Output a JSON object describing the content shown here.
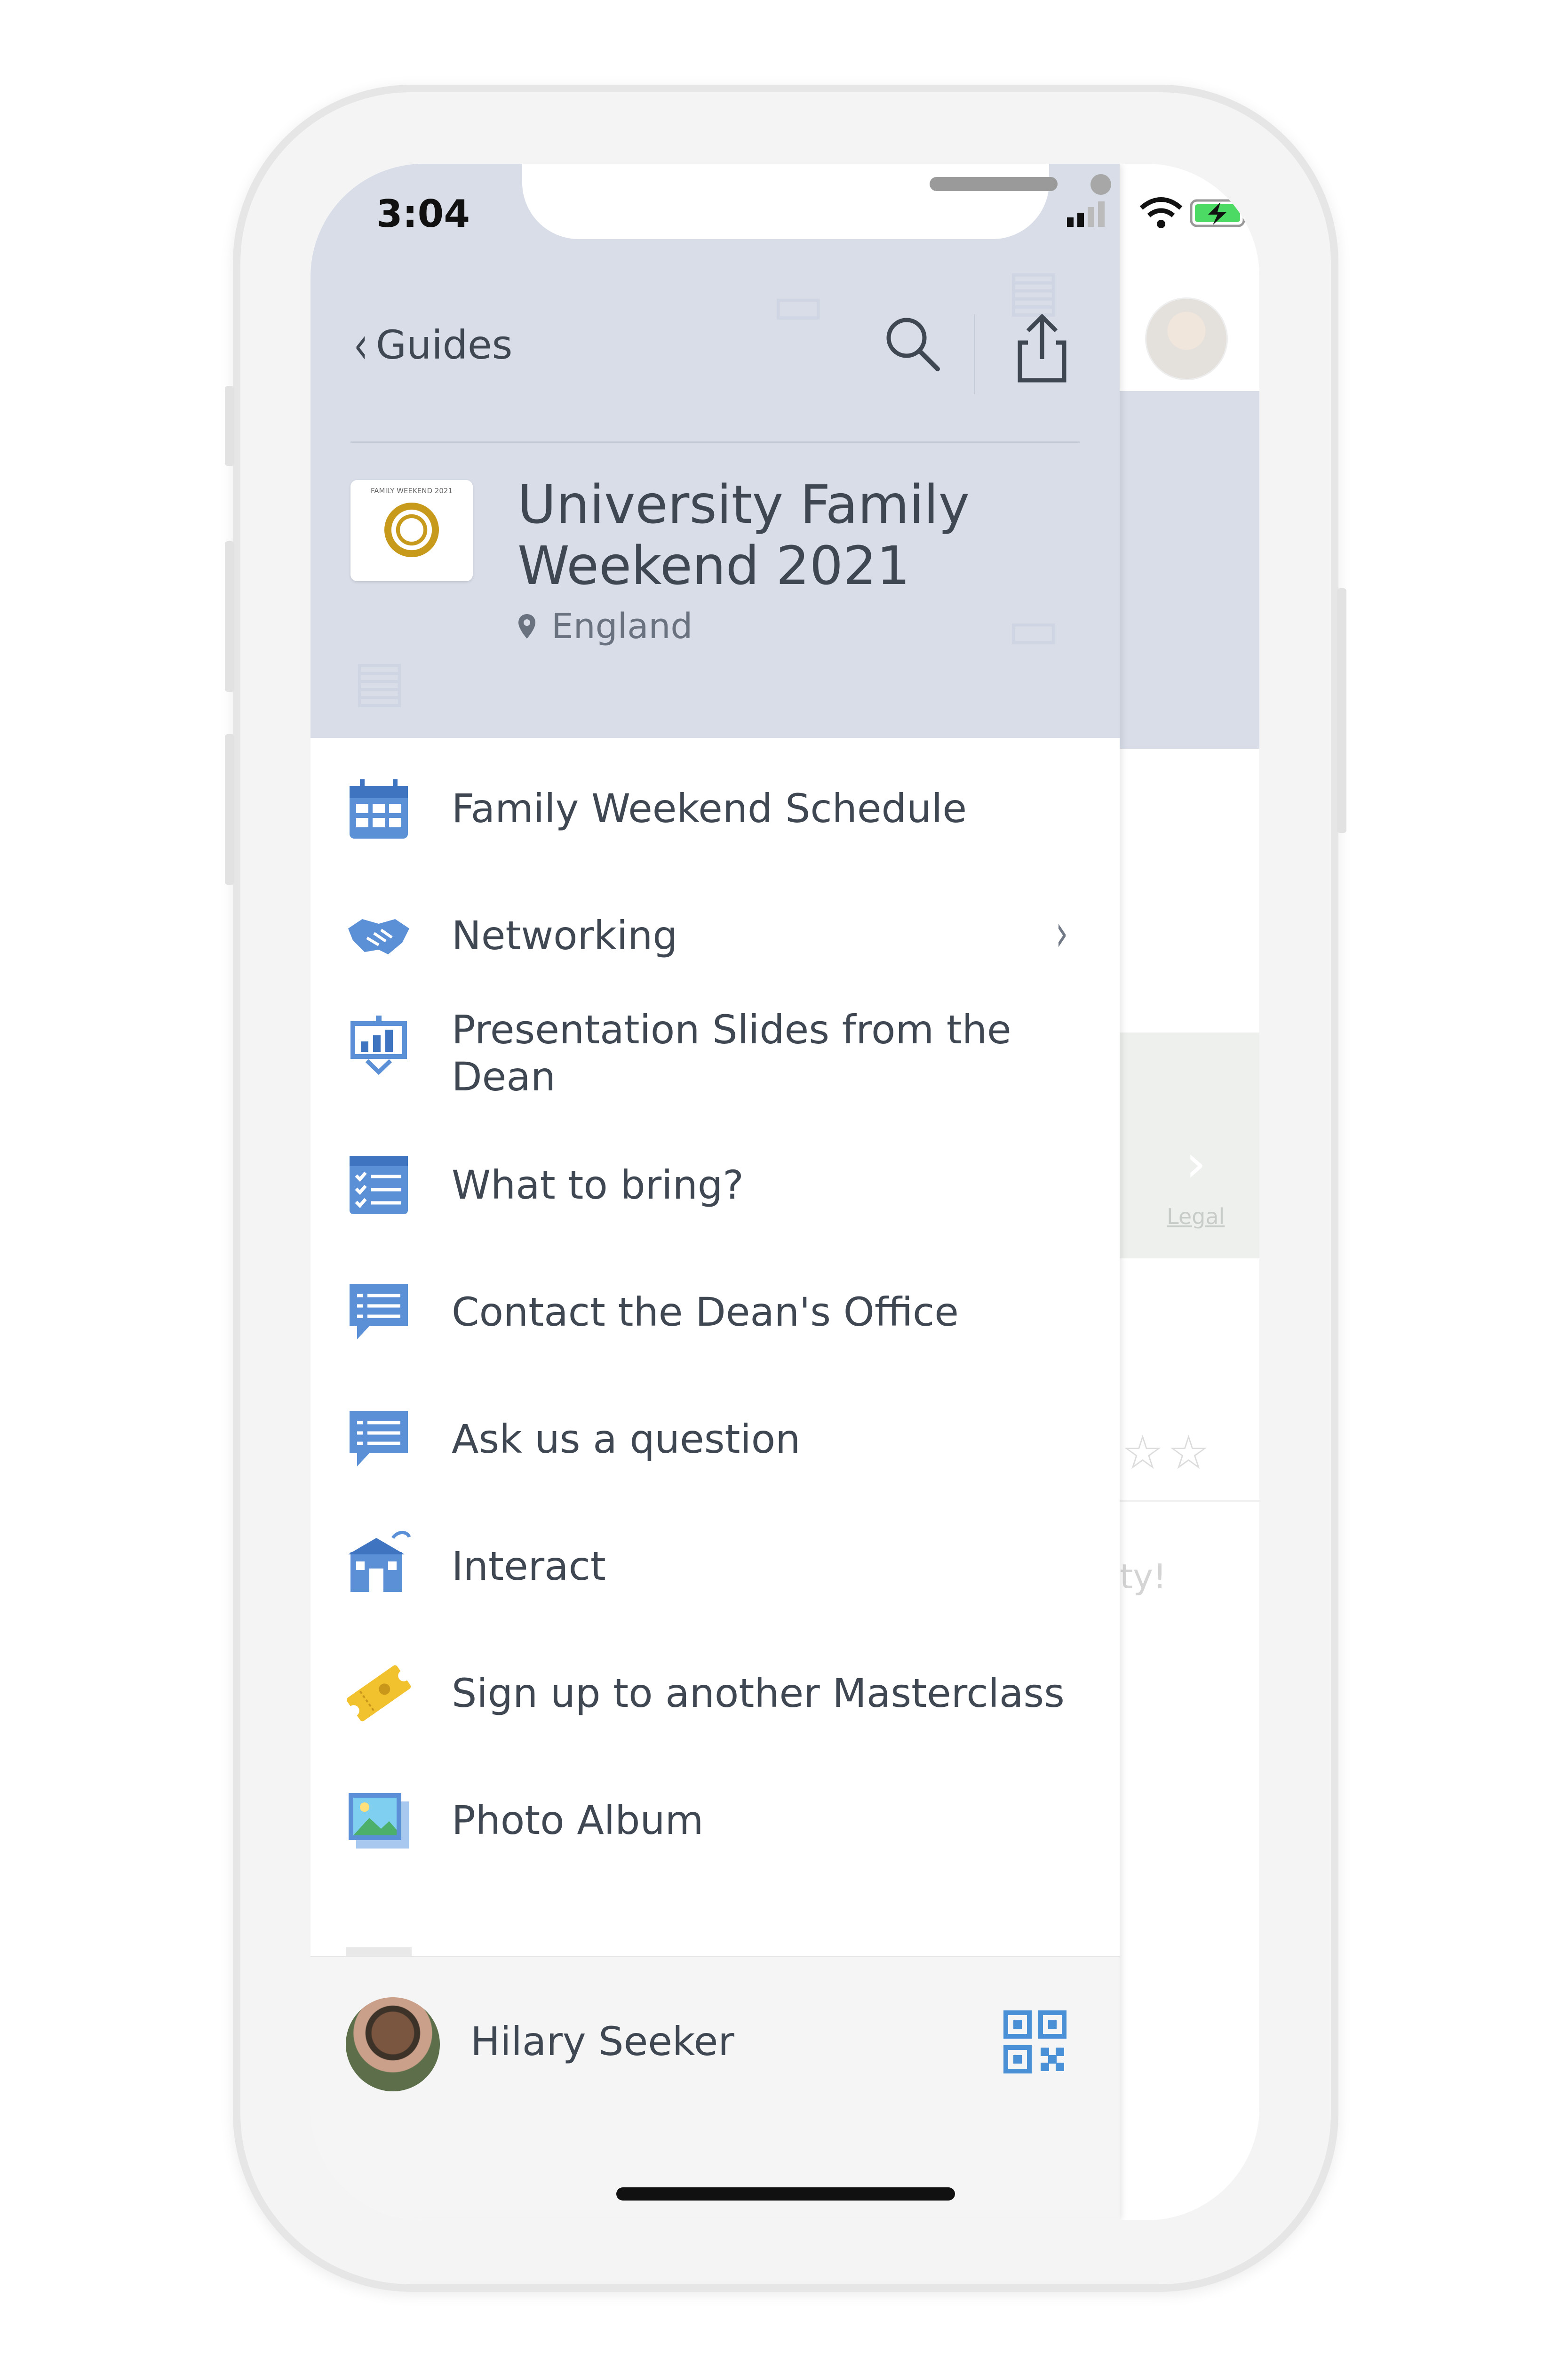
{
  "status_bar": {
    "time": "3:04"
  },
  "nav": {
    "back_label": "Guides"
  },
  "guide": {
    "title": "University Family Weekend 2021",
    "location": "England",
    "logo_caption": "FAMILY WEEKEND 2021"
  },
  "menu": {
    "items": [
      {
        "label": "Family Weekend Schedule",
        "icon": "calendar-icon"
      },
      {
        "label": "Networking",
        "icon": "handshake-icon",
        "has_children": true
      },
      {
        "label": "Presentation Slides from the Dean",
        "icon": "presentation-icon"
      },
      {
        "label": "What to bring?",
        "icon": "checklist-icon"
      },
      {
        "label": "Contact the Dean's Office",
        "icon": "message-list-icon"
      },
      {
        "label": "Ask us a question",
        "icon": "message-list-icon"
      },
      {
        "label": "Interact",
        "icon": "building-icon"
      },
      {
        "label": "Sign up to another Masterclass",
        "icon": "ticket-icon"
      },
      {
        "label": "Photo Album",
        "icon": "photo-icon"
      }
    ]
  },
  "footer": {
    "user_name": "Hilary Seeker"
  },
  "background_app": {
    "map_legal": "Legal",
    "text_fragment": "ity!"
  },
  "colors": {
    "header_bg": "#d8dde8",
    "icon_blue": "#5b8fd6",
    "text": "#3f4753",
    "ticket_yellow": "#f2c12e"
  }
}
